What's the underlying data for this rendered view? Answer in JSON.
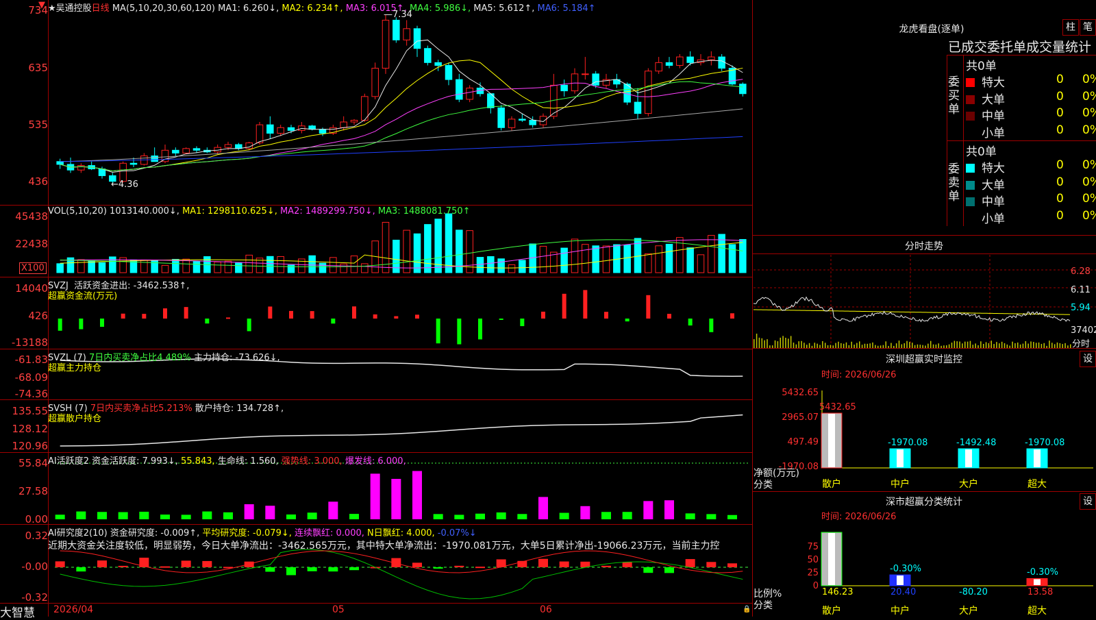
{
  "colors": {
    "up": "#ff2020",
    "down": "#00ffff",
    "grid": "#a00000",
    "bg": "#000000"
  },
  "stock": {
    "name": "吴通控股",
    "period": "日线",
    "star": "★"
  },
  "ma_header": {
    "label": "MA(5,10,20,30,60,120)",
    "ma1": "MA1: 6.260↓,",
    "ma2": "MA2: 6.234↑,",
    "ma3": "MA3: 6.015↑,",
    "ma4": "MA4: 5.986↓,",
    "ma5": "MA5: 5.612↑,",
    "ma6": "MA6: 5.184↑"
  },
  "price_axis": [
    "734",
    "635",
    "535",
    "436"
  ],
  "price_marks": {
    "high": "7.34",
    "low": "4.36"
  },
  "vol_header": {
    "label": "VOL(5,10,20)",
    "value": "1013140.000↓,",
    "ma1": "MA1: 1298110.625↓,",
    "ma2": "MA2: 1489299.750↓,",
    "ma3": "MA3: 1488081.750↑"
  },
  "vol_axis": [
    "45438",
    "22438"
  ],
  "vol_unit": "X100",
  "svzj": {
    "label": "SVZJ",
    "desc": "活跃资金进出: -3462.538↑,",
    "sub": "超赢资金流(万元)",
    "axis": [
      "14040",
      "426",
      "-13188"
    ]
  },
  "svzl": {
    "label": "SVZL (7)",
    "desc1": "7日内买卖净占比4.489%",
    "desc2": "主力持仓: -73.626↓,",
    "sub": "超赢主力持仓",
    "axis": [
      "-61.83",
      "-68.09",
      "-74.36"
    ]
  },
  "svsh": {
    "label": "SVSH (7)",
    "desc1": "7日内买卖净占比5.213%",
    "desc2": "散户持仓: 134.728↑,",
    "sub": "超赢散户持仓",
    "axis": [
      "135.55",
      "128.12",
      "120.96"
    ]
  },
  "ai_active": {
    "label": "AI活跃度2",
    "desc1": "资金活跃度: 7.993↓,",
    "desc2": "55.843,",
    "desc3": "生命线: 1.560,",
    "desc4": "强势线: 3.000,",
    "desc5": "爆发线: 6.000,",
    "axis": [
      "55.84",
      "27.58",
      "0.00"
    ]
  },
  "ai_research": {
    "label": "AI研究度2(10)",
    "desc1": "资金研究度: -0.009↑,",
    "desc2": "平均研究度: -0.079↓,",
    "desc3": "连续飘红: 0.000,",
    "desc4": "N日飘红: 4.000,",
    "desc5": "-0.07%↓",
    "commentary": "近期大资金关注度较低，明显弱势，今日大单净流出：-3462.565万元，其中特大单净流出：-1970.081万元，大单5日累计净出-19066.23万元，当前主力控",
    "axis": [
      "0.32",
      "-0.00",
      "-0.32"
    ]
  },
  "date_axis": {
    "start": "2026/04",
    "m1": "05",
    "m2": "06"
  },
  "footer_brand": "大智慧",
  "lhkp": {
    "title": "龙虎看盘(逐单)",
    "btn1": "柱",
    "btn2": "笔",
    "tabs": "已成交委托单成交量统计",
    "buy_label": "委买单",
    "sell_label": "委卖单",
    "buy_total": "共0单",
    "sell_total": "共0单",
    "buy_rows": [
      {
        "name": "特大",
        "color": "#ff0000",
        "v": "0",
        "p": "0%"
      },
      {
        "name": "大单",
        "color": "#8b0000",
        "v": "0",
        "p": "0%"
      },
      {
        "name": "中单",
        "color": "#6b0000",
        "v": "0",
        "p": "0%"
      },
      {
        "name": "小单",
        "color": "#000000",
        "v": "0",
        "p": "0%"
      }
    ],
    "sell_rows": [
      {
        "name": "特大",
        "color": "#00ffff",
        "v": "0",
        "p": "0%"
      },
      {
        "name": "大单",
        "color": "#008b8b",
        "v": "0",
        "p": "0%"
      },
      {
        "name": "中单",
        "color": "#007070",
        "v": "0",
        "p": "0%"
      },
      {
        "name": "小单",
        "color": "#000000",
        "v": "0",
        "p": "0%"
      }
    ]
  },
  "fenshi": {
    "title": "分时走势",
    "axis": [
      "6.28",
      "6.11",
      "5.94",
      "37402"
    ],
    "unit": "分时"
  },
  "sz_monitor": {
    "title": "深圳超赢实时监控",
    "btn": "设",
    "time": "时间: 2026/06/26",
    "axis": [
      "5432.65",
      "2965.07",
      "497.49",
      "-1970.08"
    ],
    "bars": [
      {
        "label": "散户",
        "value": "5432.65"
      },
      {
        "label": "中户",
        "value": "-1970.08"
      },
      {
        "label": "大户",
        "value": "-1492.48"
      },
      {
        "label": "超大",
        "value": "-1970.08"
      }
    ],
    "unit1": "净额(万元)",
    "unit2": "分类"
  },
  "sz_class": {
    "title": "深市超赢分类统计",
    "btn": "设",
    "time": "时间: 2026/06/26",
    "axis": [
      "75",
      "50",
      "25",
      "0"
    ],
    "bars": [
      {
        "label": "散户",
        "value": "146.23",
        "pct": ""
      },
      {
        "label": "中户",
        "value": "20.40",
        "pct": "-0.30%"
      },
      {
        "label": "大户",
        "value": "-80.20",
        "pct": ""
      },
      {
        "label": "超大",
        "value": "13.58",
        "pct": "-0.30%"
      }
    ],
    "unit1": "比例%",
    "unit2": "分类"
  },
  "chart_data": {
    "type": "candlestick",
    "x": [
      "2026/04",
      "05",
      "06"
    ],
    "ohlc": [
      [
        4.75,
        4.8,
        4.62,
        4.7
      ],
      [
        4.7,
        4.82,
        4.55,
        4.6
      ],
      [
        4.6,
        4.72,
        4.55,
        4.68
      ],
      [
        4.68,
        4.75,
        4.6,
        4.62
      ],
      [
        4.62,
        4.66,
        4.45,
        4.5
      ],
      [
        4.5,
        4.55,
        4.36,
        4.4
      ],
      [
        4.4,
        4.75,
        4.38,
        4.72
      ],
      [
        4.72,
        4.82,
        4.65,
        4.7
      ],
      [
        4.7,
        4.9,
        4.68,
        4.85
      ],
      [
        4.85,
        5.0,
        4.8,
        4.75
      ],
      [
        4.75,
        5.05,
        4.72,
        4.95
      ],
      [
        4.95,
        5.0,
        4.85,
        4.9
      ],
      [
        4.9,
        5.0,
        4.88,
        4.98
      ],
      [
        4.98,
        5.02,
        4.9,
        4.95
      ],
      [
        4.95,
        5.0,
        4.9,
        4.92
      ],
      [
        4.92,
        5.05,
        4.88,
        5.0
      ],
      [
        5.0,
        5.1,
        4.95,
        5.05
      ],
      [
        5.05,
        5.08,
        4.95,
        4.98
      ],
      [
        4.98,
        5.1,
        4.95,
        5.08
      ],
      [
        5.08,
        5.45,
        5.05,
        5.4
      ],
      [
        5.4,
        5.55,
        5.15,
        5.25
      ],
      [
        5.25,
        5.4,
        5.2,
        5.35
      ],
      [
        5.35,
        5.4,
        5.25,
        5.3
      ],
      [
        5.3,
        5.45,
        5.25,
        5.38
      ],
      [
        5.38,
        5.4,
        5.3,
        5.32
      ],
      [
        5.32,
        5.35,
        5.2,
        5.25
      ],
      [
        5.25,
        5.4,
        5.22,
        5.35
      ],
      [
        5.35,
        5.55,
        5.3,
        5.45
      ],
      [
        5.45,
        5.5,
        5.4,
        5.48
      ],
      [
        5.48,
        5.95,
        5.45,
        5.9
      ],
      [
        5.9,
        6.5,
        5.85,
        6.4
      ],
      [
        6.4,
        7.34,
        6.3,
        7.25
      ],
      [
        7.25,
        7.3,
        6.85,
        6.9
      ],
      [
        6.9,
        7.25,
        6.8,
        7.1
      ],
      [
        7.1,
        7.15,
        6.6,
        6.75
      ],
      [
        6.75,
        6.8,
        6.45,
        6.5
      ],
      [
        6.5,
        6.55,
        6.35,
        6.45
      ],
      [
        6.45,
        6.5,
        6.1,
        6.2
      ],
      [
        6.2,
        6.3,
        5.8,
        5.85
      ],
      [
        5.85,
        6.1,
        5.8,
        6.05
      ],
      [
        6.05,
        6.15,
        5.9,
        5.95
      ],
      [
        5.95,
        5.95,
        5.6,
        5.7
      ],
      [
        5.7,
        5.75,
        5.3,
        5.35
      ],
      [
        5.35,
        5.55,
        5.3,
        5.5
      ],
      [
        5.5,
        5.6,
        5.45,
        5.48
      ],
      [
        5.48,
        5.55,
        5.35,
        5.4
      ],
      [
        5.4,
        5.6,
        5.35,
        5.55
      ],
      [
        5.55,
        6.3,
        5.5,
        6.1
      ],
      [
        6.1,
        6.2,
        5.9,
        6.0
      ],
      [
        6.0,
        6.4,
        5.95,
        6.3
      ],
      [
        6.3,
        6.6,
        6.2,
        6.3
      ],
      [
        6.3,
        6.35,
        6.05,
        6.1
      ],
      [
        6.1,
        6.3,
        6.05,
        6.2
      ],
      [
        6.2,
        6.3,
        6.05,
        6.12
      ],
      [
        6.12,
        6.15,
        5.75,
        5.8
      ],
      [
        5.8,
        6.05,
        5.5,
        5.6
      ],
      [
        5.6,
        6.4,
        5.55,
        6.35
      ],
      [
        6.35,
        6.6,
        6.3,
        6.5
      ],
      [
        6.5,
        6.6,
        6.4,
        6.45
      ],
      [
        6.45,
        6.65,
        6.4,
        6.6
      ],
      [
        6.6,
        6.7,
        6.45,
        6.5
      ],
      [
        6.5,
        6.65,
        6.45,
        6.55
      ],
      [
        6.55,
        6.7,
        6.45,
        6.6
      ],
      [
        6.6,
        6.65,
        6.35,
        6.4
      ],
      [
        6.4,
        6.45,
        6.1,
        6.12
      ],
      [
        6.12,
        6.15,
        5.9,
        5.95
      ]
    ]
  }
}
